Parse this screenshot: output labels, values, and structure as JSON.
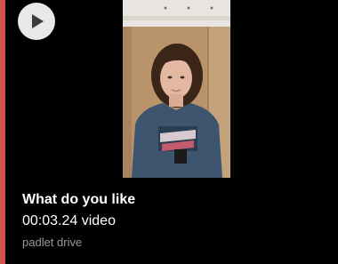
{
  "colors": {
    "background": "#000000",
    "accent": "#d4514e",
    "title_text": "#ffffff",
    "source_text": "#9a9a9a",
    "play_button": "#e8e8e8"
  },
  "player": {
    "play_icon": "play-icon"
  },
  "thumbnail": {
    "content": "video-thumbnail"
  },
  "attachment": {
    "title": "What do you like",
    "subtitle": "00:03.24 video",
    "source": "padlet drive"
  }
}
